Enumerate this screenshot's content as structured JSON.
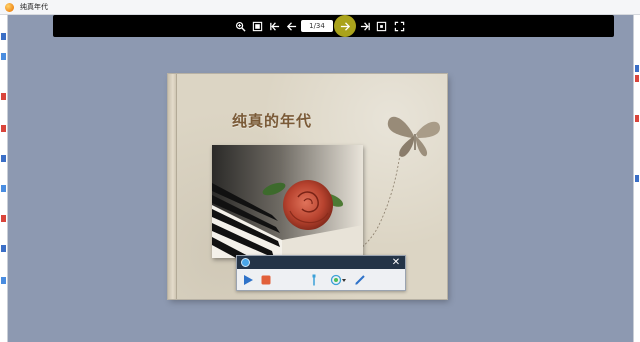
{
  "window": {
    "title": "纯真年代",
    "app_icon": "flipbook-app-icon"
  },
  "toolbar": {
    "buttons": [
      {
        "name": "zoom-in-icon"
      },
      {
        "name": "thumbnails-icon"
      },
      {
        "name": "first-page-icon"
      },
      {
        "name": "previous-page-icon"
      },
      {
        "name": "next-page-icon",
        "highlighted": true
      },
      {
        "name": "last-page-icon"
      },
      {
        "name": "fit-page-icon"
      },
      {
        "name": "fullscreen-icon"
      }
    ],
    "page_indicator": "1/34",
    "highlight_color": "#bcb51f"
  },
  "book": {
    "title": "纯真的年代",
    "title_color": "#7a5a37",
    "cover_color": "#dcd5c4",
    "image": "rose-on-piano-keys"
  },
  "recorder": {
    "header_color": "#243447",
    "close_label": "✕",
    "buttons": [
      {
        "name": "play-icon"
      },
      {
        "name": "stop-icon"
      },
      {
        "name": "pen-tool-icon"
      },
      {
        "name": "highlighter-icon"
      },
      {
        "name": "pencil-icon"
      }
    ]
  }
}
